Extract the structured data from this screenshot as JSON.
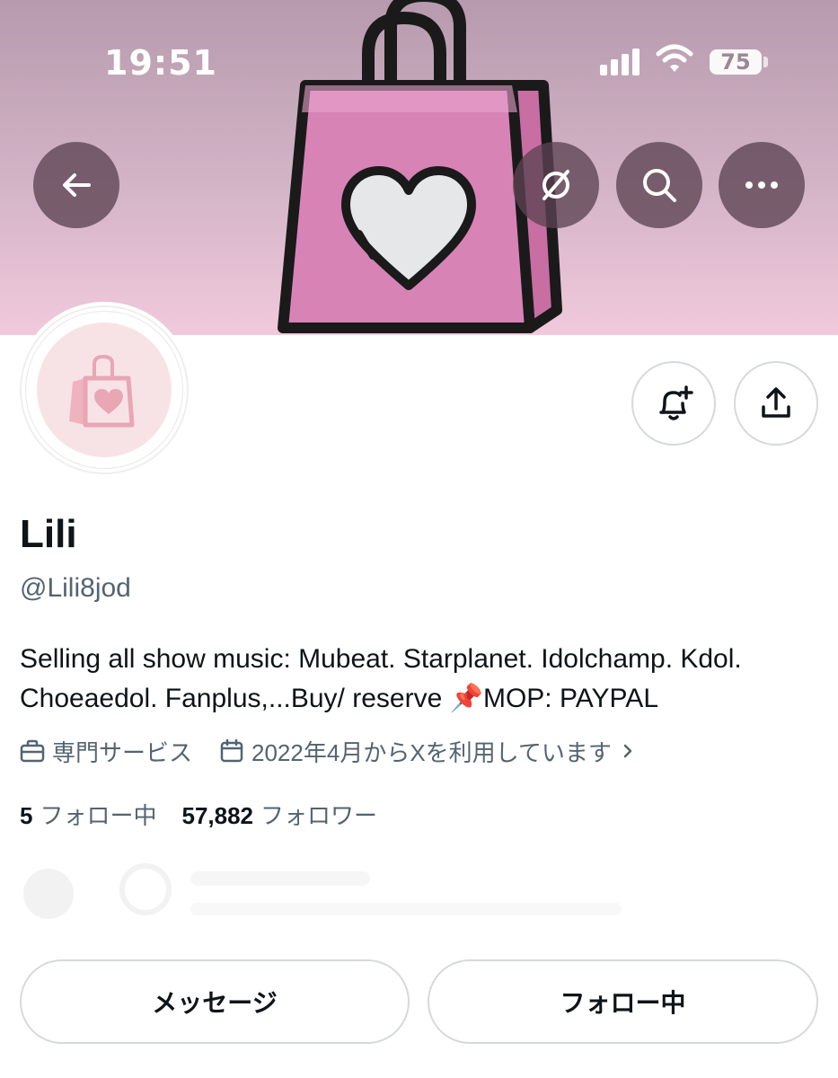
{
  "status_bar": {
    "time": "19:51",
    "battery": "75"
  },
  "profile": {
    "name": "Lili",
    "handle": "@Lili8jod",
    "bio": "Selling all show music: Mubeat. Starplanet. Idolchamp. Kdol. Choeaedol. Fanplus,...Buy/ reserve 📌MOP: PAYPAL",
    "category": "専門サービス",
    "joined": "2022年4月からXを利用しています",
    "following_count": "5",
    "following_label": "フォロー中",
    "followers_count": "57,882",
    "followers_label": "フォロワー"
  },
  "actions": {
    "message_label": "メッセージ",
    "following_button_label": "フォロー中"
  },
  "icons": {
    "back": "arrow-left-icon",
    "grok": "slash-circle-icon",
    "search": "search-icon",
    "more": "more-icon",
    "notify": "bell-plus-icon",
    "share": "share-icon",
    "category": "briefcase-icon",
    "calendar": "calendar-icon"
  },
  "colors": {
    "banner_top": "#b79aad",
    "banner_bottom": "#f1c9dc",
    "bag_pink": "#d77fb2",
    "overlay_button": "#5c4252",
    "secondary_text": "#536471"
  }
}
